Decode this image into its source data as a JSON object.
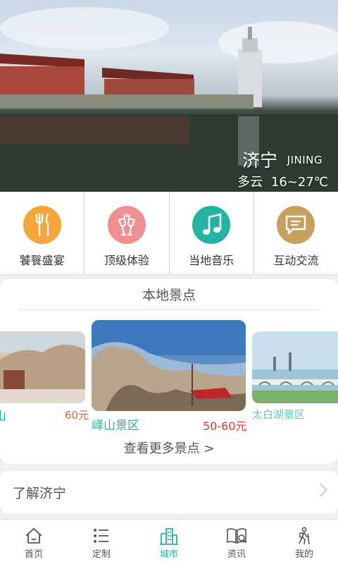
{
  "hero": {
    "city": "济宁",
    "pinyin": "JINING",
    "weather": "多云",
    "temperature": "16~27℃"
  },
  "quick_menu": [
    {
      "label": "饕餮盛宴",
      "icon": "fork-knife-icon",
      "color": "#f5a53a"
    },
    {
      "label": "顶级体验",
      "icon": "wine-glasses-icon",
      "color": "#f08f8f"
    },
    {
      "label": "当地音乐",
      "icon": "music-note-icon",
      "color": "#23b3a2"
    },
    {
      "label": "互动交流",
      "icon": "chat-bubble-icon",
      "color": "#c79f5e"
    }
  ],
  "scenic": {
    "title": "本地景点",
    "spots": [
      {
        "name": "山",
        "price": "60元"
      },
      {
        "name": "峄山景区",
        "price": "50-60元"
      },
      {
        "name": "太白湖景区",
        "price": ""
      }
    ],
    "more_label": "查看更多景点 >"
  },
  "learn": {
    "label": "了解济宁"
  },
  "tabs": [
    {
      "label": "首页",
      "icon": "home-icon",
      "active": false
    },
    {
      "label": "定制",
      "icon": "list-icon",
      "active": false
    },
    {
      "label": "城市",
      "icon": "city-icon",
      "active": true
    },
    {
      "label": "资讯",
      "icon": "news-icon",
      "active": false
    },
    {
      "label": "我的",
      "icon": "hiker-icon",
      "active": false
    }
  ],
  "colors": {
    "accent": "#23b3a2",
    "price": "#e6564a"
  }
}
